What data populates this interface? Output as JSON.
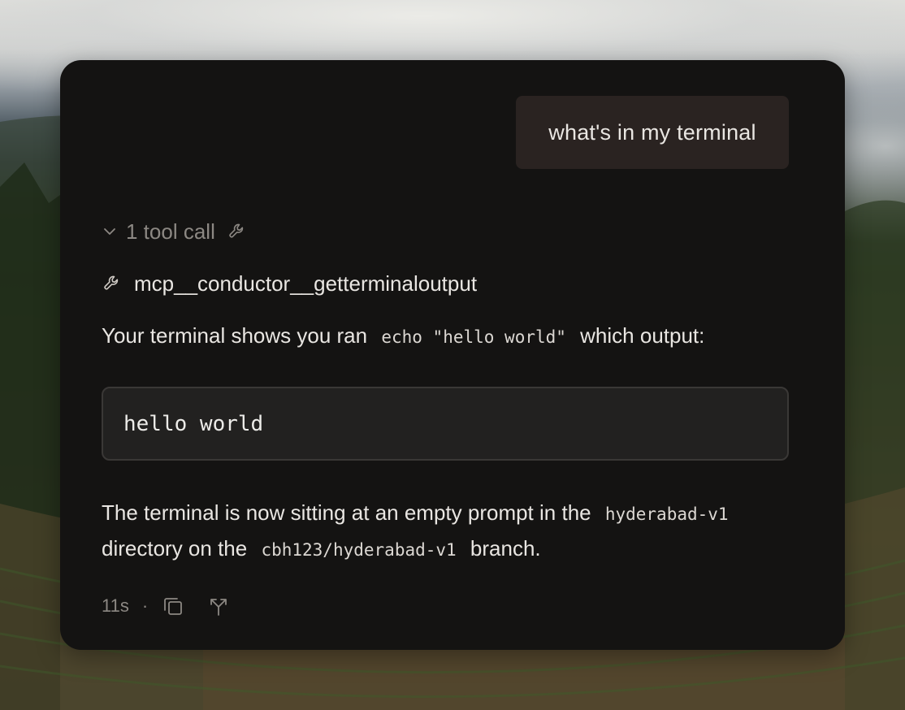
{
  "user_message": "what's in my terminal",
  "tool_calls": {
    "summary_label": "1 tool call",
    "items": [
      {
        "name": "mcp__conductor__getterminaloutput",
        "icon": "wrench-icon"
      }
    ]
  },
  "response": {
    "para1": {
      "before": "Your terminal shows you ran",
      "code": "echo \"hello world\"",
      "after": "which output:"
    },
    "code_block": "hello world",
    "para2": {
      "before": "The terminal is now sitting at an empty prompt in the",
      "code1": "hyderabad-v1",
      "middle": "directory on the",
      "code2": "cbh123/hyderabad-v1",
      "after": "branch."
    }
  },
  "footer": {
    "duration": "11s",
    "separator": "·",
    "actions": [
      "copy-icon",
      "fork-icon"
    ]
  },
  "colors": {
    "card_background": "#141312",
    "user_bubble": "#2a2321",
    "text_primary": "#e9e6e2",
    "text_muted": "#8c8883",
    "code_block_bg": "#222120"
  }
}
